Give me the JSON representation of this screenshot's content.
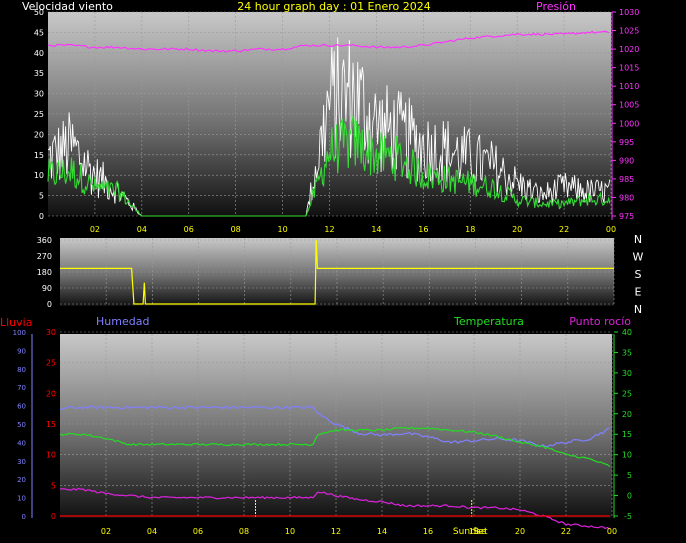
{
  "title": "24 hour graph day : 01 Enero 2024",
  "colors": {
    "wind_axis": "#ffffff",
    "wind_speed": "#ffffff",
    "wind_avg": "#33dd33",
    "pressure": "#ff33ff",
    "direction": "#ffff00",
    "rain": "#ff0000",
    "humidity": "#8080ff",
    "temperature": "#22dd22",
    "dewpoint": "#dd22dd",
    "hour_labels": "#ffff00",
    "sun_marker": "#ffff00"
  },
  "chart_data": [
    {
      "type": "line",
      "id": "wind",
      "left_label": "Velocidad viento",
      "right_label": "Presión",
      "x_ticks": [
        "02",
        "04",
        "06",
        "08",
        "10",
        "12",
        "14",
        "16",
        "18",
        "20",
        "22",
        "00"
      ],
      "x_range": [
        0,
        24
      ],
      "y_left_range": [
        0,
        50
      ],
      "y_left_ticks": [
        0,
        5,
        10,
        15,
        20,
        25,
        30,
        35,
        40,
        45,
        50
      ],
      "y_right_range": [
        975,
        1030
      ],
      "y_right_ticks": [
        975,
        980,
        985,
        990,
        995,
        1000,
        1005,
        1010,
        1015,
        1020,
        1025,
        1030
      ],
      "series": [
        {
          "id": "speed",
          "values_hourly": [
            14,
            17,
            10,
            6,
            0,
            0,
            0,
            0,
            0,
            0,
            0,
            0,
            28,
            30,
            22,
            20,
            17,
            16,
            14,
            12,
            8,
            5,
            7,
            6
          ]
        },
        {
          "id": "avg",
          "values_hourly": [
            10,
            11,
            7,
            6,
            0,
            0,
            0,
            0,
            0,
            0,
            0,
            0,
            16,
            18,
            15,
            14,
            10,
            9,
            8,
            7,
            4,
            3,
            3,
            4
          ]
        },
        {
          "id": "pressure",
          "x": [
            0,
            1,
            2,
            3,
            4,
            5,
            6,
            7,
            8,
            9,
            10,
            11,
            12,
            13,
            14,
            15,
            16,
            17,
            18,
            19,
            20,
            21,
            22,
            23,
            24
          ],
          "values": [
            1021,
            1021,
            1020.5,
            1020.5,
            1020,
            1020,
            1020,
            1019.5,
            1019.5,
            1020,
            1020,
            1021,
            1021,
            1021,
            1020.5,
            1020.5,
            1021,
            1022,
            1023,
            1023.5,
            1024,
            1024,
            1024,
            1024.5,
            1024.5
          ]
        }
      ]
    },
    {
      "type": "line",
      "id": "direction",
      "right_labels": [
        "N",
        "W",
        "S",
        "E",
        "N"
      ],
      "y_range": [
        0,
        360
      ],
      "y_ticks": [
        0,
        90,
        180,
        270,
        360
      ],
      "series": [
        {
          "id": "bearing",
          "x": [
            0,
            3.1,
            3.2,
            3.6,
            3.65,
            3.7,
            4.1,
            4.15,
            4.2,
            11.0,
            11.05,
            11.1,
            11.15,
            24
          ],
          "values": [
            200,
            200,
            0,
            0,
            120,
            0,
            0,
            0,
            0,
            0,
            0,
            360,
            200,
            200
          ]
        }
      ]
    },
    {
      "type": "line",
      "id": "thermo",
      "label_rain": "Lluvia",
      "label_humidity": "Humedad",
      "label_temperature": "Temperatura",
      "label_dewpoint": "Punto rocío",
      "x_ticks": [
        "02",
        "04",
        "06",
        "08",
        "10",
        "12",
        "14",
        "16",
        "18",
        "20",
        "22",
        "00"
      ],
      "x_range": [
        0,
        24
      ],
      "y_humidity_range": [
        0,
        100
      ],
      "y_humidity_ticks": [
        0,
        10,
        20,
        30,
        40,
        50,
        60,
        70,
        80,
        90,
        100
      ],
      "y_rain_range": [
        0,
        30
      ],
      "y_rain_ticks": [
        0,
        5,
        10,
        15,
        20,
        25,
        30
      ],
      "y_temp_range": [
        -5,
        40
      ],
      "y_temp_ticks": [
        -5,
        0,
        5,
        10,
        15,
        20,
        25,
        30,
        35,
        40
      ],
      "sunrise_label": "Sunrise",
      "sunset_label": "Set",
      "sunrise_hour": 8.5,
      "sunset_hour": 17.9,
      "series": [
        {
          "id": "humidity",
          "x": [
            0,
            0.5,
            1,
            2,
            3,
            4,
            5,
            6,
            7,
            8,
            9,
            10,
            11,
            11.3,
            12,
            13,
            14,
            15,
            16,
            17,
            18,
            19,
            20,
            21,
            22,
            23,
            24
          ],
          "values": [
            58,
            59,
            59,
            59,
            59,
            59,
            59,
            59,
            59,
            59,
            59,
            59,
            59,
            55,
            50,
            45,
            44,
            45,
            43,
            40,
            41,
            42,
            41,
            38,
            40,
            42,
            48
          ]
        },
        {
          "id": "temperature",
          "x": [
            0,
            1,
            2,
            3,
            4,
            5,
            6,
            7,
            8,
            9,
            10,
            11,
            11.2,
            12,
            13,
            14,
            15,
            16,
            17,
            18,
            19,
            20,
            21,
            22,
            23,
            24
          ],
          "values": [
            15,
            15,
            14,
            12.5,
            12.5,
            12.5,
            12.5,
            12.5,
            12.5,
            12.5,
            12.5,
            12.5,
            15,
            16,
            16,
            16,
            16.5,
            16.5,
            16,
            15.5,
            14.5,
            13,
            12,
            10,
            9,
            7
          ]
        },
        {
          "id": "dewpoint",
          "x": [
            0,
            1,
            2,
            3,
            4,
            5,
            6,
            7,
            8,
            9,
            10,
            11,
            11.2,
            12,
            13,
            14,
            15,
            16,
            17,
            18,
            19,
            20,
            21,
            22,
            23,
            24
          ],
          "values": [
            1.5,
            1.5,
            0.5,
            0,
            -0.5,
            -0.5,
            -0.5,
            -0.5,
            -0.5,
            -0.5,
            -0.5,
            -0.5,
            1,
            0,
            -1,
            -1.5,
            -2.5,
            -2.5,
            -2.5,
            -3,
            -3,
            -3.5,
            -5,
            -7,
            -7.5,
            -8
          ]
        },
        {
          "id": "rain",
          "x": [
            0,
            24
          ],
          "values": [
            0,
            0
          ]
        }
      ]
    }
  ]
}
